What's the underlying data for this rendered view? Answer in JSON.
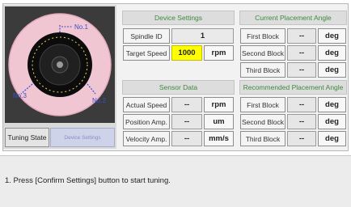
{
  "wheel_image": {
    "labels": [
      "No.1",
      "No.2",
      "No.3"
    ],
    "colors": {
      "disc": "#f0c6d3",
      "hub": "#0c0c0c",
      "ring": "#f0d060",
      "label": "#3a4fd0",
      "background": "#3b3b3b"
    }
  },
  "tuning": {
    "label": "Tuning State",
    "value": "Device Settings"
  },
  "device_settings": {
    "title": "Device Settings",
    "spindle_id_label": "Spindle ID",
    "spindle_id_value": "1",
    "target_speed_label": "Target Speed",
    "target_speed_value": "1000",
    "target_speed_unit": "rpm"
  },
  "sensor_data": {
    "title": "Sensor Data",
    "rows": [
      {
        "label": "Actual Speed",
        "value": "--",
        "unit": "rpm"
      },
      {
        "label": "Position Amp.",
        "value": "--",
        "unit": "um"
      },
      {
        "label": "Velocity Amp.",
        "value": "--",
        "unit": "mm/s"
      }
    ]
  },
  "current_placement": {
    "title": "Current Placement Angle",
    "rows": [
      {
        "label": "First Block",
        "value": "--",
        "unit": "deg"
      },
      {
        "label": "Second Block",
        "value": "--",
        "unit": "deg"
      },
      {
        "label": "Third Block",
        "value": "--",
        "unit": "deg"
      }
    ]
  },
  "recommended_placement": {
    "title": "Recommended Placement Angle",
    "rows": [
      {
        "label": "First Block",
        "value": "--",
        "unit": "deg"
      },
      {
        "label": "Second Block",
        "value": "--",
        "unit": "deg"
      },
      {
        "label": "Third Block",
        "value": "--",
        "unit": "deg"
      }
    ]
  },
  "message": {
    "text": "1. Press [Confirm Settings] button to start tuning."
  },
  "colors": {
    "header_text": "#3d8a3d",
    "highlight": "#ffff00"
  }
}
